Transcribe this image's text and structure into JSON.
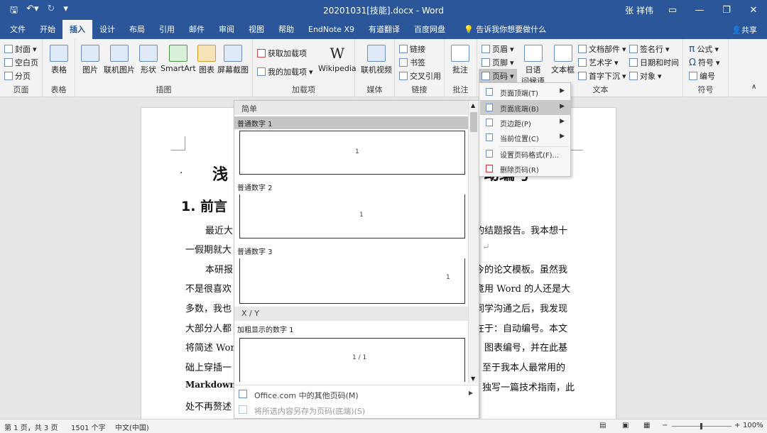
{
  "window": {
    "title": "20201031[技能].docx  -  Word",
    "user": "张 祥伟",
    "save_icon": "save-icon"
  },
  "tabs": [
    "文件",
    "开始",
    "插入",
    "设计",
    "布局",
    "引用",
    "邮件",
    "审阅",
    "视图",
    "帮助",
    "EndNote X9",
    "有道翻译",
    "百度网盘"
  ],
  "active_tab": "插入",
  "tell_me": "告诉我你想要做什么",
  "share": "共享",
  "ribbon": {
    "pages": {
      "items": [
        "封面",
        "空白页",
        "分页"
      ],
      "label": "页面"
    },
    "tables": {
      "item": "表格",
      "label": "表格"
    },
    "illustrations": {
      "items": [
        "图片",
        "联机图片",
        "形状",
        "SmartArt",
        "图表",
        "屏幕截图"
      ],
      "label": "插图"
    },
    "addins": {
      "get": "获取加载项",
      "mine": "我的加载项",
      "wiki": "Wikipedia",
      "label": "加载项"
    },
    "media": {
      "item": "联机视频",
      "label": "媒体"
    },
    "links": {
      "items": [
        "链接",
        "书签",
        "交叉引用"
      ],
      "label": "链接"
    },
    "comments": {
      "item": "批注",
      "label": "批注"
    },
    "header_footer": {
      "items": [
        "页眉",
        "页脚",
        "页码"
      ]
    },
    "text": {
      "datetime_stack": "日语",
      "datetime2": "问候语",
      "textbox": "文本框",
      "parts": "文档部件",
      "wordart": "艺术字",
      "dropcap": "首字下沉",
      "sig": "签名行",
      "date": "日期和时间",
      "object": "对象",
      "label": "文本"
    },
    "symbols": {
      "formula": "公式",
      "symbol": "符号",
      "number": "编号",
      "label": "符号"
    }
  },
  "document": {
    "title": "浅",
    "title_tail": "动编号",
    "heading": "1. 前言",
    "lines": [
      {
        "left": "最近大",
        "right": "的结题报告。我本想十"
      },
      {
        "left": "一假期就大",
        "right": ""
      },
      {
        "left": "本研报",
        "right": "今的论文模板。虽然我"
      },
      {
        "left": "不是很喜欢",
        "right": "竟用 Word 的人还是大"
      },
      {
        "left": "多数，我也",
        "right": "同学沟通之后，我发现"
      },
      {
        "left": "大部分人都",
        "right": "在于：自动编号。本文"
      },
      {
        "left": "将简述 Wor",
        "right": "、图表编号，并在此基"
      },
      {
        "left": "础上穿插一",
        "right": "至于我本人最常用的"
      },
      {
        "left": "Markdown +",
        "right": "独写一篇技术指南，此"
      },
      {
        "left": "处不再赘述",
        "right": ""
      }
    ]
  },
  "gallery": {
    "sections": [
      "简单",
      "X / Y"
    ],
    "items": [
      {
        "label": "普通数字 1",
        "num": "1"
      },
      {
        "label": "普通数字 2",
        "num": "1"
      },
      {
        "label": "普通数字 3",
        "num": "1"
      },
      {
        "label": "加粗显示的数字 1",
        "num": "1 / 1"
      }
    ],
    "footer1": "Office.com 中的其他页码(M)",
    "footer2": "将所选内容另存为页码(底端)(S)"
  },
  "submenu": {
    "items": [
      "页面顶端(T)",
      "页面底端(B)",
      "页边距(P)",
      "当前位置(C)",
      "设置页码格式(F)...",
      "删除页码(R)"
    ]
  },
  "status": {
    "page": "第 1 页，共 3 页",
    "words": "1501 个字",
    "lang": "中文(中国)",
    "zoom": "100%"
  },
  "colors": {
    "brand": "#2b579a"
  }
}
